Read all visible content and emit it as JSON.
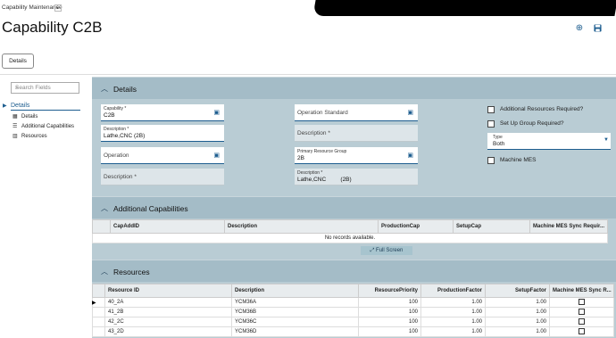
{
  "app": {
    "name": "Capability Maintenance",
    "caret": "▸"
  },
  "header": {
    "title": "Capability C2B",
    "add_icon": "⊕",
    "save_icon": "💾"
  },
  "tabs": {
    "details": "Details"
  },
  "sidebar": {
    "search_placeholder": "Search Fields",
    "root": "Details",
    "items": [
      {
        "icon": "details-icon",
        "glyph": "▦",
        "label": "Details"
      },
      {
        "icon": "list-icon",
        "glyph": "☰",
        "label": "Additional Capabilities"
      },
      {
        "icon": "grid-icon",
        "glyph": "▥",
        "label": "Resources"
      }
    ]
  },
  "details": {
    "title": "Details",
    "capability": {
      "label": "Capability *",
      "value": "C2B"
    },
    "description1": {
      "label": "Description *",
      "value": "Lathe,CNC (2B)"
    },
    "operation": {
      "placeholder": "Operation"
    },
    "description2": {
      "placeholder": "Description *"
    },
    "operation_standard": {
      "placeholder": "Operation Standard"
    },
    "description3": {
      "placeholder": "Description *"
    },
    "primary_resource_group": {
      "label": "Primary Resource Group",
      "value": "2B"
    },
    "description4": {
      "label": "Description *",
      "value": "Lathe,CNC         (2B)"
    },
    "additional_resources": "Additional Resources Required?",
    "setup_group": "Set Up Group Required?",
    "type": {
      "label": "Type",
      "value": "Both"
    },
    "machine_mes": "Machine MES"
  },
  "additional_capabilities": {
    "title": "Additional Capabilities",
    "columns": [
      "CapAddID",
      "Description",
      "ProductionCap",
      "SetupCap",
      "Machine MES Sync Requir..."
    ],
    "empty_text": "No records available.",
    "full_screen": "⤢ Full Screen"
  },
  "resources": {
    "title": "Resources",
    "columns": [
      "Resource ID",
      "Description",
      "ResourcePriority",
      "ProductionFactor",
      "SetupFactor",
      "Machine MES Sync R..."
    ],
    "rows": [
      {
        "id": "40_2A",
        "desc": "YCM36A",
        "priority": "100",
        "prod": "1.00",
        "setup": "1.00"
      },
      {
        "id": "41_2B",
        "desc": "YCM36B",
        "priority": "100",
        "prod": "1.00",
        "setup": "1.00"
      },
      {
        "id": "42_2C",
        "desc": "YCM36C",
        "priority": "100",
        "prod": "1.00",
        "setup": "1.00"
      },
      {
        "id": "43_2D",
        "desc": "YCM36D",
        "priority": "100",
        "prod": "1.00",
        "setup": "1.00"
      }
    ]
  }
}
